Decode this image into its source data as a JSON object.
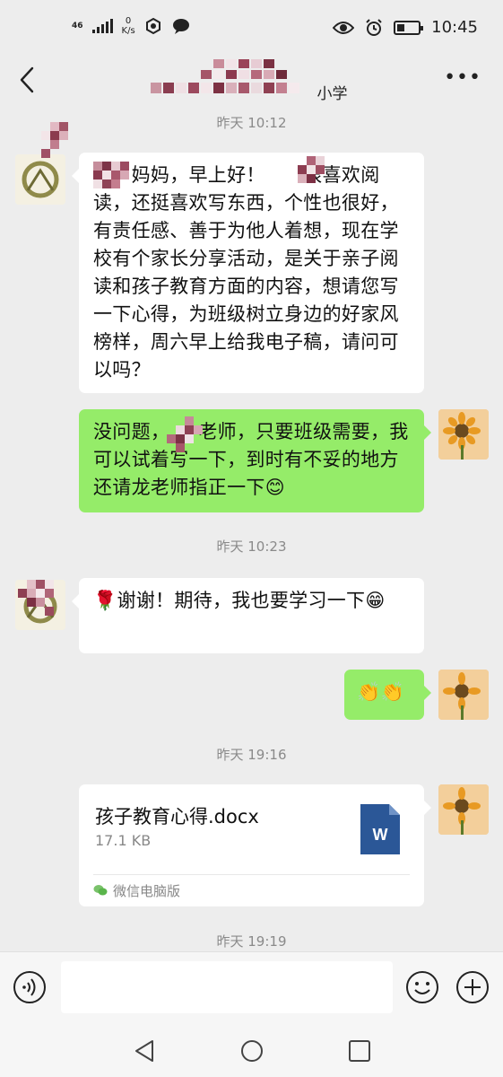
{
  "status_bar": {
    "network": "4G",
    "signal_label": "46",
    "net_speed_value": "0",
    "net_speed_unit": "K/s",
    "time": "10:45",
    "battery_level": 0.35,
    "icons": [
      "signal-icon",
      "shield-icon",
      "chat-icon",
      "eye-icon",
      "alarm-icon",
      "battery-icon"
    ]
  },
  "nav": {
    "title": "小学",
    "back_icon": "chevron-left-icon",
    "more_icon": "more-dots-icon"
  },
  "messages": [
    {
      "type": "timestamp",
      "text": "昨天 10:12"
    },
    {
      "type": "text",
      "direction": "incoming",
      "text": "　　妈妈，早上好！　　很喜欢阅读，还挺喜欢写东西，个性也很好，有责任感、善于为他人着想，现在学校有个家长分享活动，是关于亲子阅读和孩子教育方面的内容，想请您写一下心得，为班级树立身边的好家风榜样，周六早上给我电子稿，请问可以吗？"
    },
    {
      "type": "text",
      "direction": "outgoing",
      "text": "没问题，　　老师，只要班级需要，我可以试着写一下，到时有不妥的地方还请龙老师指正一下😊"
    },
    {
      "type": "timestamp",
      "text": "昨天 10:23"
    },
    {
      "type": "text",
      "direction": "incoming",
      "text": "🌹谢谢！期待，我也要学习一下😁"
    },
    {
      "type": "text",
      "direction": "outgoing",
      "text": "👏👏"
    },
    {
      "type": "timestamp",
      "text": "昨天 19:16"
    },
    {
      "type": "file",
      "direction": "outgoing",
      "file_name": "孩子教育心得.docx",
      "file_size": "17.1 KB",
      "source": "微信电脑版",
      "file_icon": "word-document-icon"
    },
    {
      "type": "timestamp",
      "text": "昨天 19:19"
    }
  ],
  "input_bar": {
    "placeholder": "",
    "voice_icon": "voice-icon",
    "emoji_icon": "emoji-icon",
    "plus_icon": "plus-icon"
  },
  "system_nav": [
    "back-triangle-icon",
    "home-circle-icon",
    "recents-square-icon"
  ],
  "colors": {
    "background": "#ededed",
    "outgoing_bubble": "#95ec69",
    "incoming_bubble": "#ffffff",
    "timestamp_text": "#8a8a8a",
    "word_blue": "#2b5797"
  }
}
